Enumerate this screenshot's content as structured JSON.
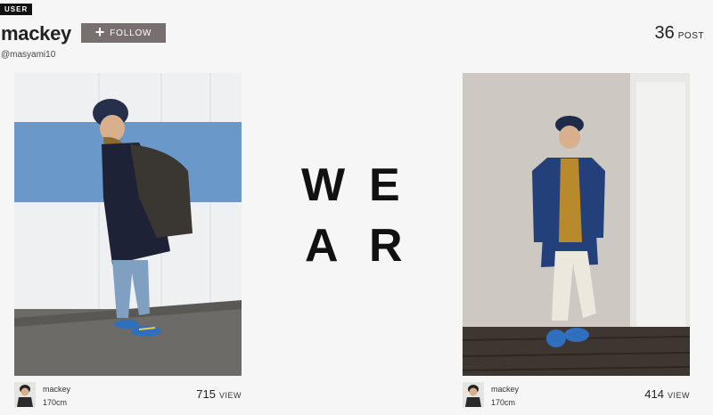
{
  "profile": {
    "badge": "USER",
    "username": "mackey",
    "handle": "@masyami10",
    "follow_label": "FOLLOW",
    "post_count": "36",
    "post_unit": "POST"
  },
  "logo": {
    "letters": [
      "W",
      "E",
      "A",
      "R"
    ]
  },
  "posts": [
    {
      "user": "mackey",
      "height": "170cm",
      "views": "715",
      "views_unit": "VIEW"
    },
    {
      "user": "mackey",
      "height": "170cm",
      "views": "414",
      "views_unit": "VIEW"
    }
  ],
  "colors": {
    "follow_button": "#787070",
    "badge_bg": "#111111",
    "stripe_blue": "#6a98c8"
  }
}
